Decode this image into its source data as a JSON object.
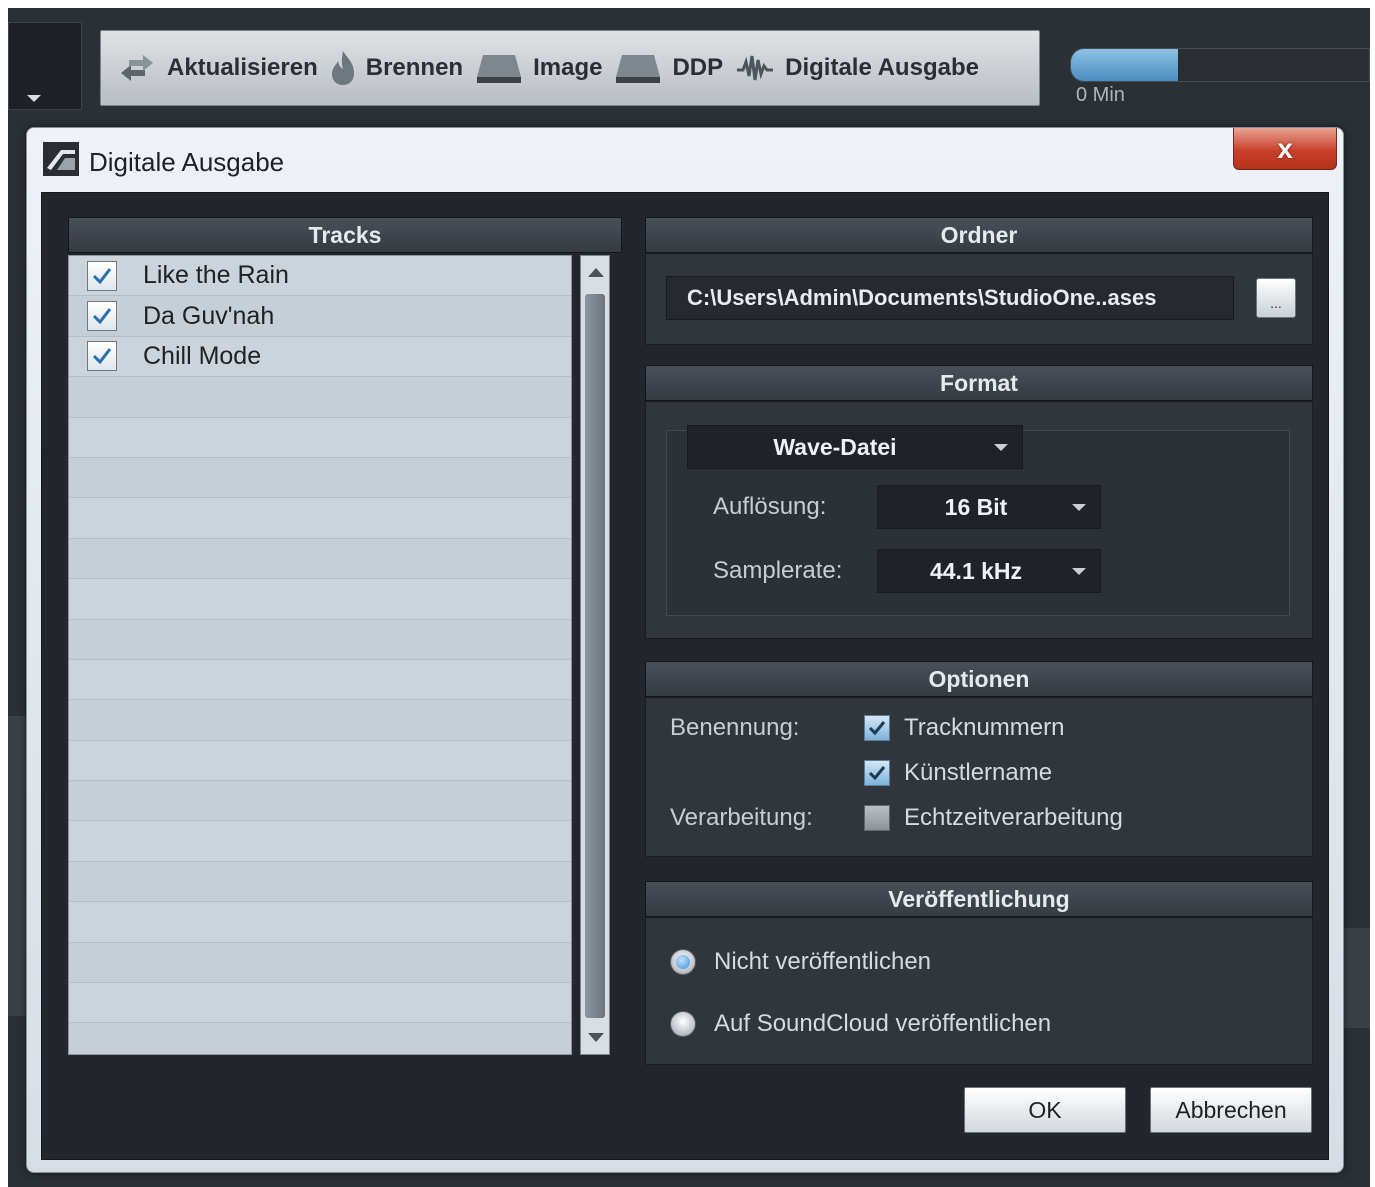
{
  "toolbar": {
    "buttons": [
      {
        "label": "Aktualisieren",
        "icon": "refresh-arrows-icon"
      },
      {
        "label": "Brennen",
        "icon": "flame-icon"
      },
      {
        "label": "Image",
        "icon": "disc-drive-icon"
      },
      {
        "label": "DDP",
        "icon": "disc-drive-icon"
      },
      {
        "label": "Digitale Ausgabe",
        "icon": "waveform-icon"
      }
    ],
    "progress_label": "0 Min",
    "progress_fraction": 0.36
  },
  "dialog": {
    "title": "Digitale Ausgabe",
    "close_label": "x",
    "tracks": {
      "header": "Tracks",
      "items": [
        {
          "name": "Like the Rain",
          "checked": true
        },
        {
          "name": "Da Guv'nah",
          "checked": true
        },
        {
          "name": "Chill Mode",
          "checked": true
        }
      ]
    },
    "folder": {
      "header": "Ordner",
      "path": "C:\\Users\\Admin\\Documents\\StudioOne..ases",
      "browse_label": "..."
    },
    "format": {
      "header": "Format",
      "file_type": "Wave-Datei",
      "resolution_label": "Auflösung:",
      "resolution_value": "16 Bit",
      "samplerate_label": "Samplerate:",
      "samplerate_value": "44.1 kHz"
    },
    "options": {
      "header": "Optionen",
      "naming_label": "Benennung:",
      "tracknumbers_label": "Tracknummern",
      "tracknumbers_checked": true,
      "artistname_label": "Künstlername",
      "artistname_checked": true,
      "processing_label": "Verarbeitung:",
      "realtime_label": "Echtzeitverarbeitung",
      "realtime_checked": false
    },
    "publish": {
      "header": "Veröffentlichung",
      "option_none": "Nicht veröffentlichen",
      "option_soundcloud": "Auf SoundCloud veröffentlichen",
      "selected": "none"
    },
    "ok_label": "OK",
    "cancel_label": "Abbrechen"
  },
  "colors": {
    "accent": "#4a8ec0",
    "close_red": "#c9402a",
    "panel_dark": "#23272c"
  }
}
